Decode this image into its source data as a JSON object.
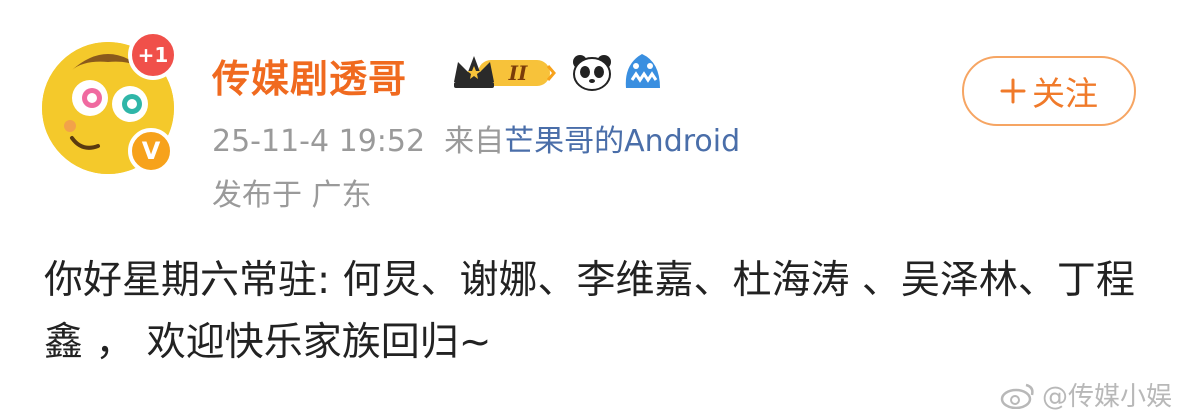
{
  "post": {
    "author": {
      "name": "传媒剧透哥",
      "notification_badge": "+1",
      "verified_mark": "V",
      "level_badge": "II"
    },
    "timestamp": "25-11-4 19:52",
    "source_prefix": "来自",
    "source": "芒果哥的Android",
    "location": "发布于 广东",
    "follow_label": "关注",
    "follow_icon": "plus-icon",
    "content": "你好星期六常驻: 何炅、谢娜、李维嘉、杜海涛 、吴泽林、丁程鑫 ， 欢迎快乐家族回归~"
  },
  "watermark": {
    "text": "@传媒小娱"
  },
  "colors": {
    "username": "#f06a1f",
    "source_link": "#4a6ea9",
    "follow_border": "#f6a563",
    "meta_gray": "#9a9a9a"
  }
}
